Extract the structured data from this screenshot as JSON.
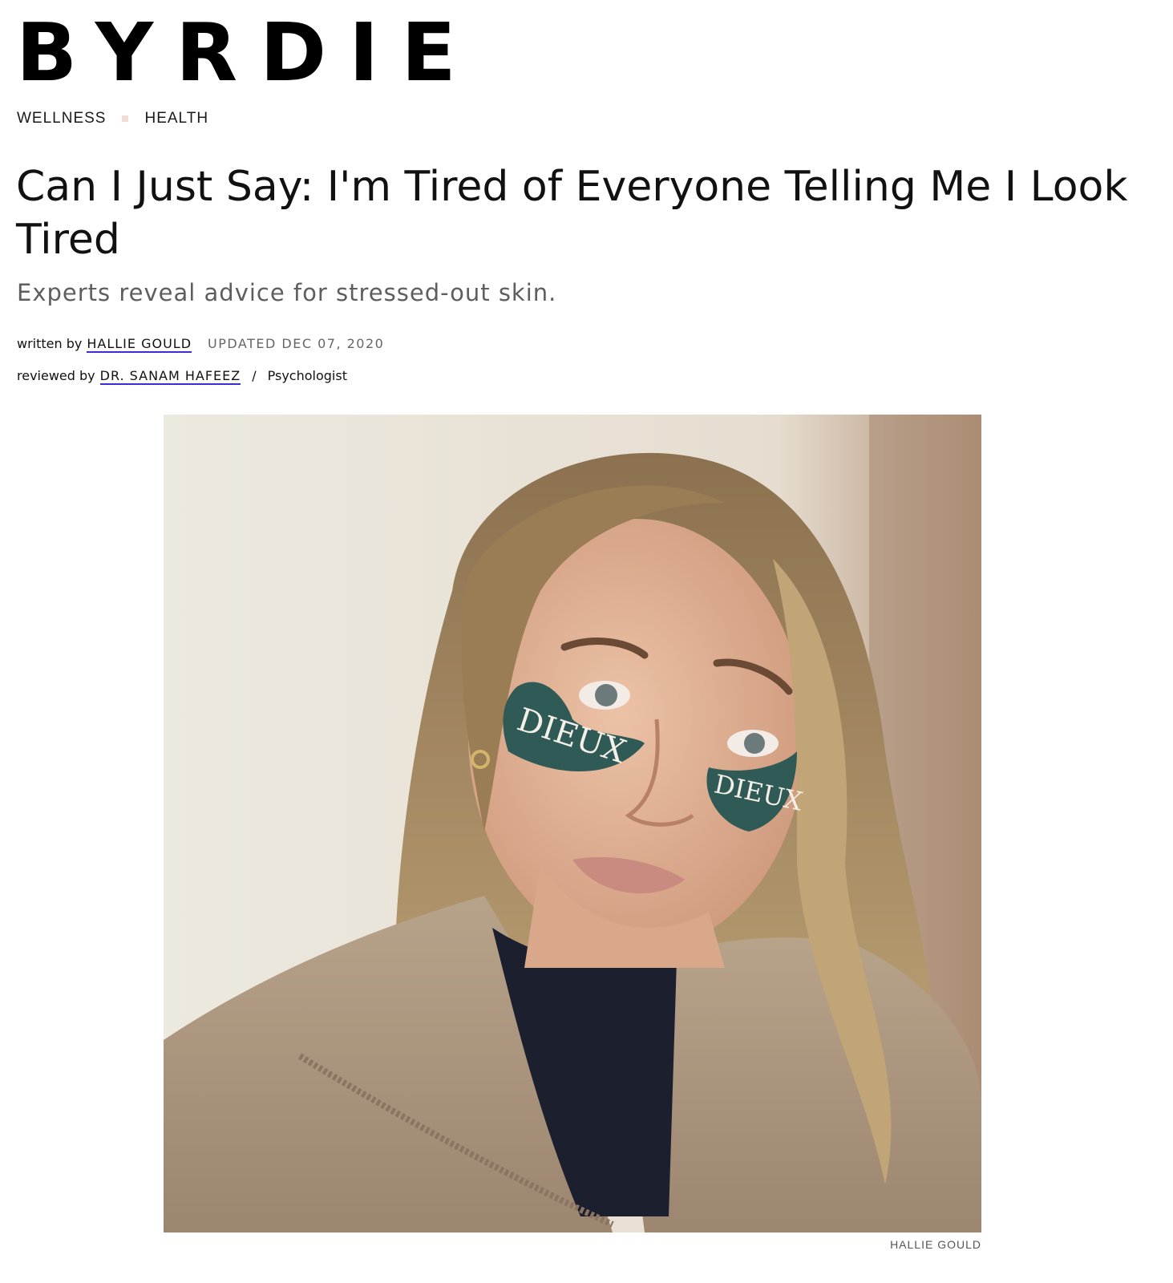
{
  "site": {
    "logo": "BYRDIE"
  },
  "breadcrumb": [
    {
      "label": "WELLNESS"
    },
    {
      "label": "HEALTH"
    }
  ],
  "article": {
    "title": "Can I Just Say: I'm Tired of Everyone Telling Me I Look Tired",
    "dek": "Experts reveal advice for stressed-out skin.",
    "byline": {
      "written_prefix": "written by",
      "author": "HALLIE GOULD",
      "updated": "UPDATED DEC 07, 2020",
      "reviewed_prefix": "reviewed by",
      "reviewer": "DR. SANAM HAFEEZ",
      "separator": "/",
      "reviewer_role": "Psychologist"
    },
    "image": {
      "patch_text": "DIEUX",
      "credit": "HALLIE GOULD"
    }
  }
}
